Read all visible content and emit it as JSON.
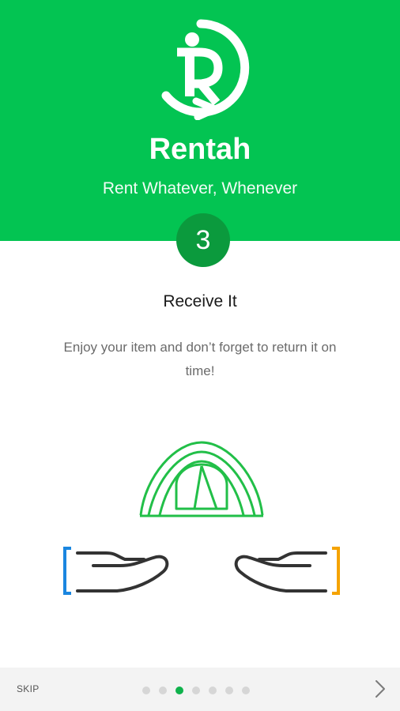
{
  "header": {
    "app_name": "Rentah",
    "tagline": "Rent Whatever, Whenever",
    "brand_color": "#03c452"
  },
  "step": {
    "number": "3",
    "title": "Receive It",
    "description": "Enjoy your item and don’t forget to return it on time!"
  },
  "footer": {
    "skip_label": "SKIP",
    "pages": 7,
    "current_page": 3,
    "next_icon": "chevron-right-icon"
  },
  "colors": {
    "badge": "#0b9a3d",
    "dot_active": "#0fb24c",
    "dot_inactive": "#d6d6d6",
    "left_bracket": "#1a86e0",
    "right_bracket": "#f5a300",
    "tent": "#22bf48"
  }
}
